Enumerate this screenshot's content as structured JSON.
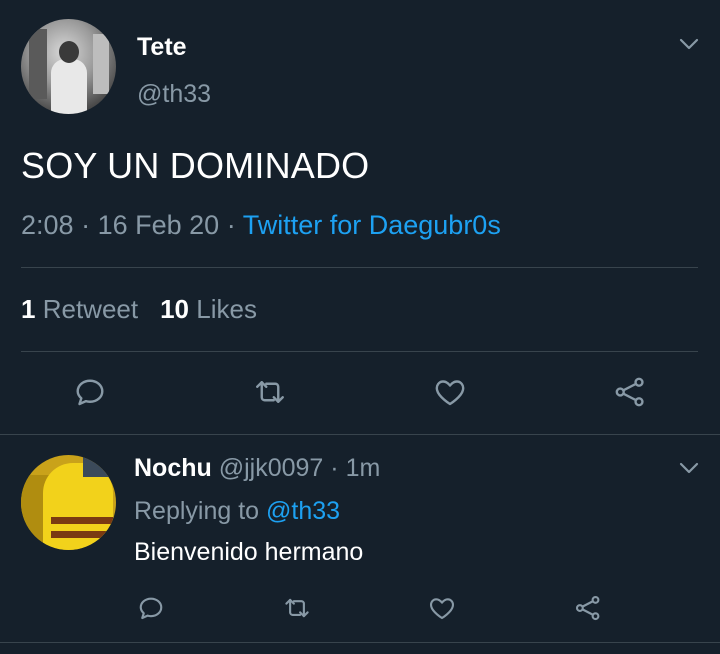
{
  "main_tweet": {
    "author_name": "Tete",
    "author_handle": "@th33",
    "text": "SOY UN DOMINADO",
    "time": "2:08",
    "separator": "·",
    "date": "16 Feb 20",
    "source": "Twitter for Daegubr0s",
    "retweet_count": "1",
    "retweet_label": "Retweet",
    "like_count": "10",
    "like_label": "Likes"
  },
  "reply": {
    "author_name": "Nochu",
    "author_handle": "@jjk0097",
    "separator": "·",
    "time_ago": "1m",
    "replying_to_label": "Replying to",
    "replying_to_handle": "@th33",
    "text": "Bienvenido hermano"
  },
  "icons": {
    "reply": "reply-icon",
    "retweet": "retweet-icon",
    "like": "heart-icon",
    "share": "share-icon",
    "more": "chevron-down-icon"
  },
  "colors": {
    "background": "#15202b",
    "accent": "#1da1f2",
    "muted": "#8899a6",
    "divider": "#38444d"
  }
}
